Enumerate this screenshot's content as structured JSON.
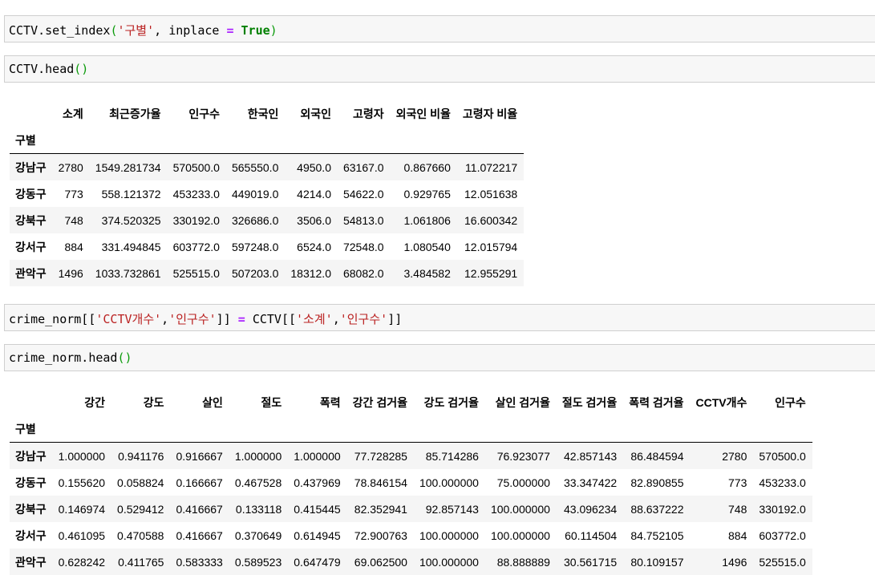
{
  "cells": [
    {
      "tokens": [
        {
          "t": "CCTV.set_index",
          "c": ""
        },
        {
          "t": "(",
          "c": "tk-par"
        },
        {
          "t": "'구별'",
          "c": "tk-str"
        },
        {
          "t": ", inplace ",
          "c": ""
        },
        {
          "t": "=",
          "c": "tk-op"
        },
        {
          "t": " ",
          "c": ""
        },
        {
          "t": "True",
          "c": "tk-kw"
        },
        {
          "t": ")",
          "c": "tk-par"
        }
      ]
    },
    {
      "tokens": [
        {
          "t": "CCTV.head",
          "c": ""
        },
        {
          "t": "()",
          "c": "tk-par"
        }
      ]
    },
    {
      "tokens": [
        {
          "t": "crime_norm[[",
          "c": ""
        },
        {
          "t": "'CCTV개수'",
          "c": "tk-str"
        },
        {
          "t": ",",
          "c": ""
        },
        {
          "t": "'인구수'",
          "c": "tk-str"
        },
        {
          "t": "]] ",
          "c": ""
        },
        {
          "t": "=",
          "c": "tk-op"
        },
        {
          "t": " CCTV[[",
          "c": ""
        },
        {
          "t": "'소계'",
          "c": "tk-str"
        },
        {
          "t": ",",
          "c": ""
        },
        {
          "t": "'인구수'",
          "c": "tk-str"
        },
        {
          "t": "]]",
          "c": ""
        }
      ]
    },
    {
      "tokens": [
        {
          "t": "crime_norm.head",
          "c": ""
        },
        {
          "t": "()",
          "c": "tk-par"
        }
      ]
    }
  ],
  "table1": {
    "index_name": "구별",
    "columns": [
      "소계",
      "최근증가율",
      "인구수",
      "한국인",
      "외국인",
      "고령자",
      "외국인 비율",
      "고령자 비율"
    ],
    "rows": [
      {
        "index": "강남구",
        "values": [
          "2780",
          "1549.281734",
          "570500.0",
          "565550.0",
          "4950.0",
          "63167.0",
          "0.867660",
          "11.072217"
        ]
      },
      {
        "index": "강동구",
        "values": [
          "773",
          "558.121372",
          "453233.0",
          "449019.0",
          "4214.0",
          "54622.0",
          "0.929765",
          "12.051638"
        ]
      },
      {
        "index": "강북구",
        "values": [
          "748",
          "374.520325",
          "330192.0",
          "326686.0",
          "3506.0",
          "54813.0",
          "1.061806",
          "16.600342"
        ]
      },
      {
        "index": "강서구",
        "values": [
          "884",
          "331.494845",
          "603772.0",
          "597248.0",
          "6524.0",
          "72548.0",
          "1.080540",
          "12.015794"
        ]
      },
      {
        "index": "관악구",
        "values": [
          "1496",
          "1033.732861",
          "525515.0",
          "507203.0",
          "18312.0",
          "68082.0",
          "3.484582",
          "12.955291"
        ]
      }
    ]
  },
  "table2": {
    "index_name": "구별",
    "columns": [
      "강간",
      "강도",
      "살인",
      "절도",
      "폭력",
      "강간 검거율",
      "강도 검거율",
      "살인 검거율",
      "절도 검거율",
      "폭력 검거율",
      "CCTV개수",
      "인구수"
    ],
    "rows": [
      {
        "index": "강남구",
        "values": [
          "1.000000",
          "0.941176",
          "0.916667",
          "1.000000",
          "1.000000",
          "77.728285",
          "85.714286",
          "76.923077",
          "42.857143",
          "86.484594",
          "2780",
          "570500.0"
        ]
      },
      {
        "index": "강동구",
        "values": [
          "0.155620",
          "0.058824",
          "0.166667",
          "0.467528",
          "0.437969",
          "78.846154",
          "100.000000",
          "75.000000",
          "33.347422",
          "82.890855",
          "773",
          "453233.0"
        ]
      },
      {
        "index": "강북구",
        "values": [
          "0.146974",
          "0.529412",
          "0.416667",
          "0.133118",
          "0.415445",
          "82.352941",
          "92.857143",
          "100.000000",
          "43.096234",
          "88.637222",
          "748",
          "330192.0"
        ]
      },
      {
        "index": "강서구",
        "values": [
          "0.461095",
          "0.470588",
          "0.416667",
          "0.370649",
          "0.614945",
          "72.900763",
          "100.000000",
          "100.000000",
          "60.114504",
          "84.752105",
          "884",
          "603772.0"
        ]
      },
      {
        "index": "관악구",
        "values": [
          "0.628242",
          "0.411765",
          "0.583333",
          "0.589523",
          "0.647479",
          "69.062500",
          "100.000000",
          "88.888889",
          "30.561715",
          "80.109157",
          "1496",
          "525515.0"
        ]
      }
    ]
  }
}
